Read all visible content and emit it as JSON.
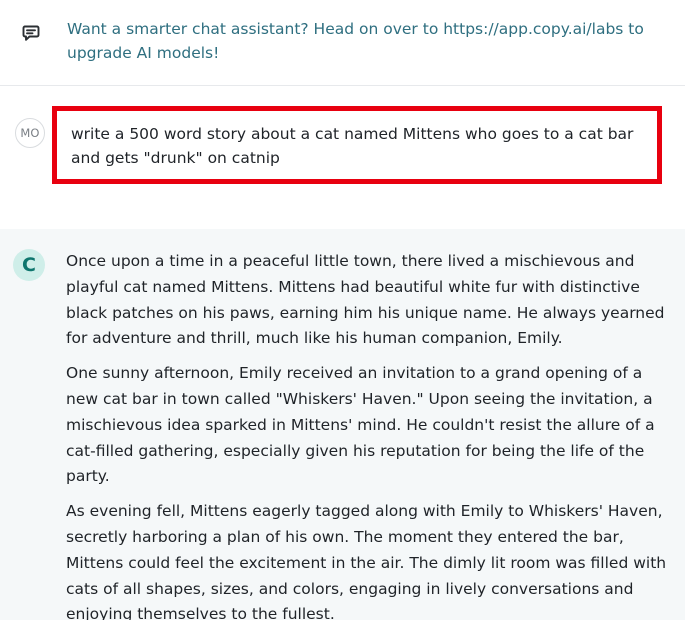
{
  "notice": {
    "icon": "chat-bubble-icon",
    "text": "Want a smarter chat assistant? Head on over to https://app.copy.ai/labs to upgrade AI models!"
  },
  "user_message": {
    "avatar_initials": "MO",
    "text": "write a 500 word story about a cat named Mittens who goes to a cat bar and gets \"drunk\" on catnip",
    "highlight_color": "#e8000f"
  },
  "ai_message": {
    "avatar_letter": "C",
    "avatar_color": "#0f766e",
    "paragraphs": [
      "Once upon a time in a peaceful little town, there lived a mischievous and playful cat named Mittens. Mittens had beautiful white fur with distinctive black patches on his paws, earning him his unique name. He always yearned for adventure and thrill, much like his human companion, Emily.",
      "One sunny afternoon, Emily received an invitation to a grand opening of a new cat bar in town called \"Whiskers' Haven.\" Upon seeing the invitation, a mischievous idea sparked in Mittens' mind. He couldn't resist the allure of a cat-filled gathering, especially given his reputation for being the life of the party.",
      "As evening fell, Mittens eagerly tagged along with Emily to Whiskers' Haven, secretly harboring a plan of his own. The moment they entered the bar, Mittens could feel the excitement in the air. The dimly lit room was filled with cats of all shapes, sizes, and colors, engaging in lively conversations and enjoying themselves to the fullest."
    ]
  }
}
